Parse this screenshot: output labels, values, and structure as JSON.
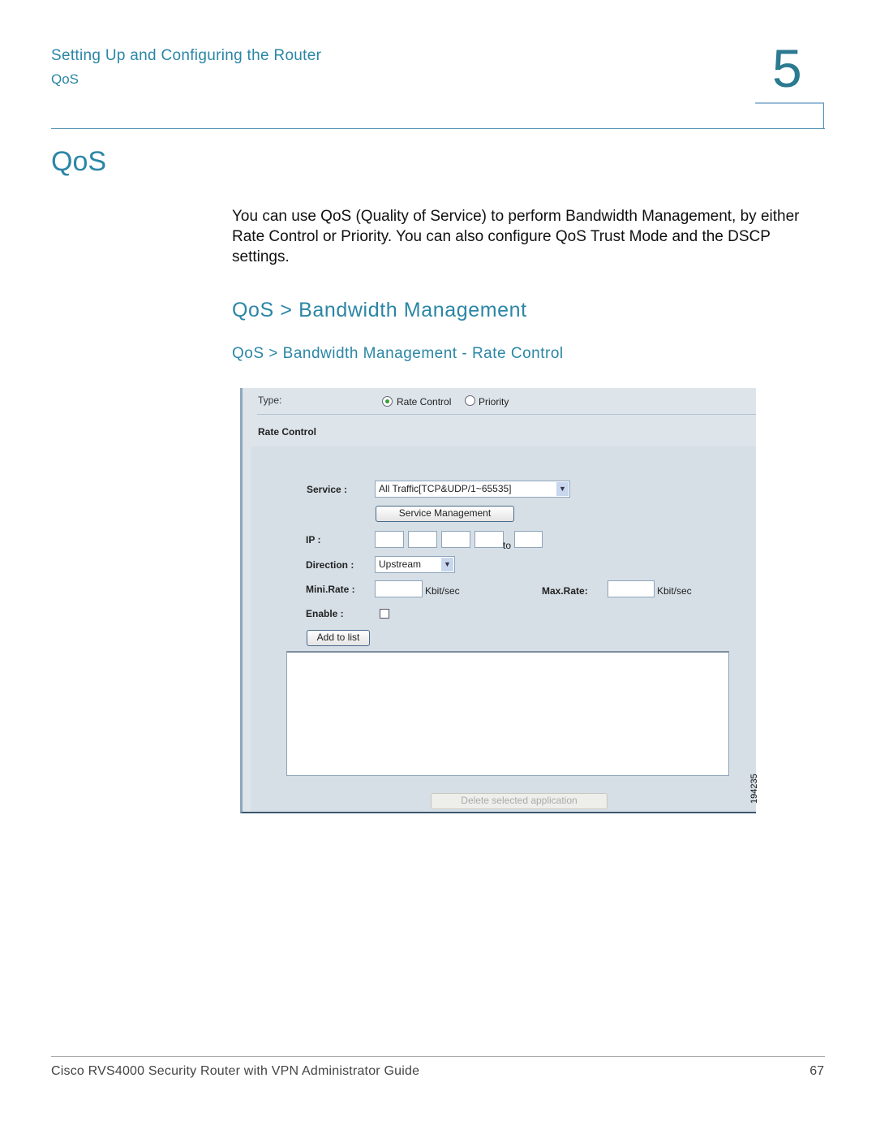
{
  "header": {
    "chapter_title": "Setting Up and Configuring the Router",
    "section": "QoS",
    "chapter_number": "5"
  },
  "title": "QoS",
  "intro": "You can use QoS (Quality of Service) to perform Bandwidth Management, by either Rate Control or Priority. You can also configure QoS Trust Mode and the DSCP settings.",
  "heading2": "QoS > Bandwidth Management",
  "heading3": "QoS > Bandwidth Management - Rate Control",
  "screenshot": {
    "type_label": "Type:",
    "type_options": [
      {
        "label": "Rate Control",
        "selected": true
      },
      {
        "label": "Priority",
        "selected": false
      }
    ],
    "section_label": "Rate Control",
    "service_label": "Service :",
    "service_value": "All Traffic[TCP&UDP/1~65535]",
    "service_mgmt_button": "Service Management",
    "ip_label": "IP :",
    "ip_to": "to",
    "direction_label": "Direction :",
    "direction_value": "Upstream",
    "min_rate_label": "Mini.Rate :",
    "max_rate_label": "Max.Rate:",
    "rate_unit": "Kbit/sec",
    "enable_label": "Enable :",
    "enable_checked": false,
    "add_button": "Add to list",
    "delete_button": "Delete selected application",
    "figure_id": "194235"
  },
  "footer": {
    "guide": "Cisco RVS4000 Security Router with VPN Administrator Guide",
    "page": "67"
  }
}
